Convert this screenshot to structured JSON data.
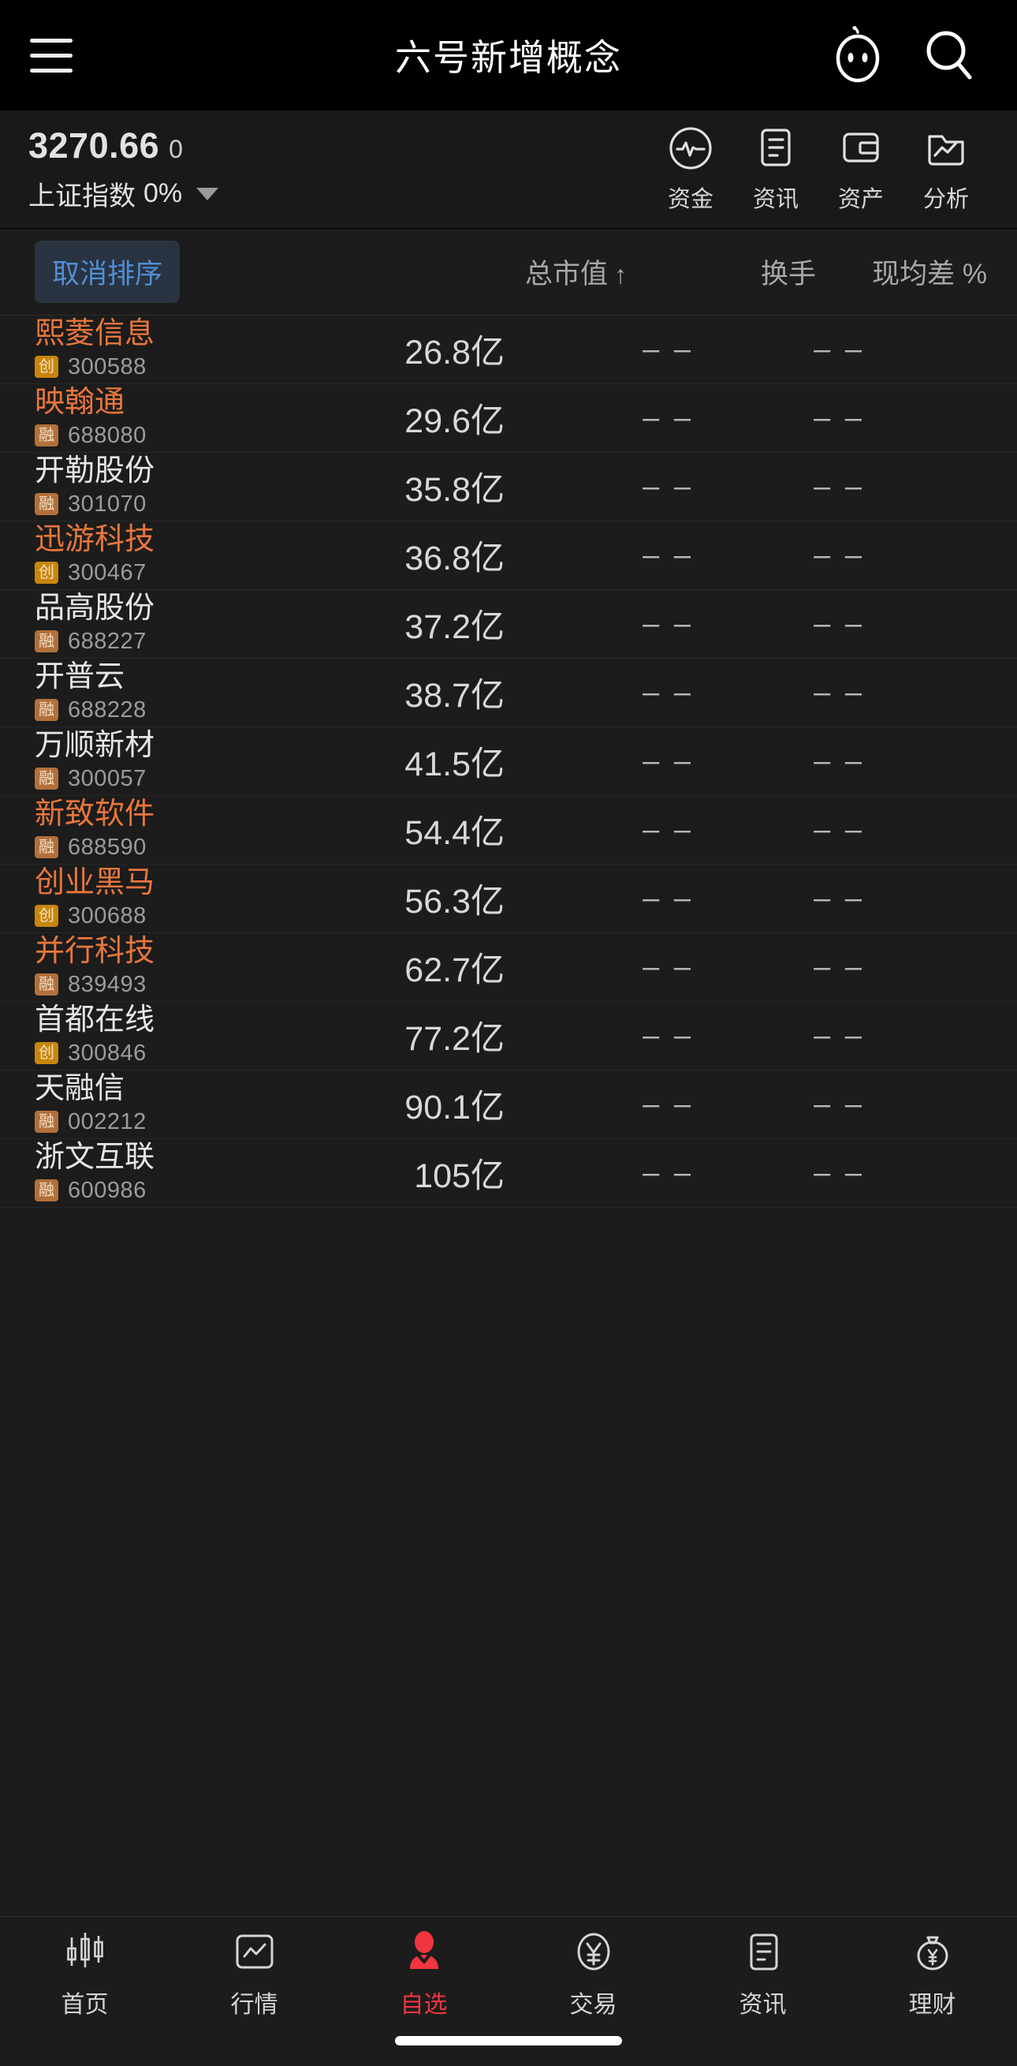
{
  "header": {
    "title": "六号新增概念",
    "menu_icon": "hamburger-menu-icon",
    "robot_icon": "robot-assistant-icon",
    "search_icon": "search-icon"
  },
  "index": {
    "value": "3270.66",
    "change": "0",
    "name": "上证指数",
    "percent": "0%",
    "dropdown_icon": "caret-down-icon"
  },
  "tools": [
    {
      "label": "资金",
      "icon": "pulse-circle-icon"
    },
    {
      "label": "资讯",
      "icon": "document-lines-icon"
    },
    {
      "label": "资产",
      "icon": "wallet-icon"
    },
    {
      "label": "分析",
      "icon": "folder-chart-icon"
    }
  ],
  "columns": {
    "sort_button": "取消排序",
    "market_cap": "总市值",
    "market_cap_arrow": "↑",
    "turnover": "换手",
    "diff": "现均差 %"
  },
  "colors": {
    "up": "#e8763c",
    "flat": "#e6e6e6",
    "accent_blue": "#4f8fd6",
    "active_red": "#f0353f",
    "badge_chuang": "#c8860d",
    "badge_rong": "#b2703a"
  },
  "stocks": [
    {
      "name": "熙菱信息",
      "badge": "创",
      "badge_type": "chuang",
      "code": "300588",
      "market_cap": "26.8亿",
      "turnover": "– –",
      "diff": "– –",
      "trend": "up"
    },
    {
      "name": "映翰通",
      "badge": "融",
      "badge_type": "rong",
      "code": "688080",
      "market_cap": "29.6亿",
      "turnover": "– –",
      "diff": "– –",
      "trend": "up"
    },
    {
      "name": "开勒股份",
      "badge": "融",
      "badge_type": "rong",
      "code": "301070",
      "market_cap": "35.8亿",
      "turnover": "– –",
      "diff": "– –",
      "trend": "flat"
    },
    {
      "name": "迅游科技",
      "badge": "创",
      "badge_type": "chuang",
      "code": "300467",
      "market_cap": "36.8亿",
      "turnover": "– –",
      "diff": "– –",
      "trend": "up"
    },
    {
      "name": "品高股份",
      "badge": "融",
      "badge_type": "rong",
      "code": "688227",
      "market_cap": "37.2亿",
      "turnover": "– –",
      "diff": "– –",
      "trend": "flat"
    },
    {
      "name": "开普云",
      "badge": "融",
      "badge_type": "rong",
      "code": "688228",
      "market_cap": "38.7亿",
      "turnover": "– –",
      "diff": "– –",
      "trend": "flat"
    },
    {
      "name": "万顺新材",
      "badge": "融",
      "badge_type": "rong",
      "code": "300057",
      "market_cap": "41.5亿",
      "turnover": "– –",
      "diff": "– –",
      "trend": "flat"
    },
    {
      "name": "新致软件",
      "badge": "融",
      "badge_type": "rong",
      "code": "688590",
      "market_cap": "54.4亿",
      "turnover": "– –",
      "diff": "– –",
      "trend": "up"
    },
    {
      "name": "创业黑马",
      "badge": "创",
      "badge_type": "chuang",
      "code": "300688",
      "market_cap": "56.3亿",
      "turnover": "– –",
      "diff": "– –",
      "trend": "up"
    },
    {
      "name": "并行科技",
      "badge": "融",
      "badge_type": "rong",
      "code": "839493",
      "market_cap": "62.7亿",
      "turnover": "– –",
      "diff": "– –",
      "trend": "up"
    },
    {
      "name": "首都在线",
      "badge": "创",
      "badge_type": "chuang",
      "code": "300846",
      "market_cap": "77.2亿",
      "turnover": "– –",
      "diff": "– –",
      "trend": "flat"
    },
    {
      "name": "天融信",
      "badge": "融",
      "badge_type": "rong",
      "code": "002212",
      "market_cap": "90.1亿",
      "turnover": "– –",
      "diff": "– –",
      "trend": "flat"
    },
    {
      "name": "浙文互联",
      "badge": "融",
      "badge_type": "rong",
      "code": "600986",
      "market_cap": "105亿",
      "turnover": "– –",
      "diff": "– –",
      "trend": "flat"
    }
  ],
  "bottom_nav": [
    {
      "label": "首页",
      "icon": "candlestick-icon",
      "active": false
    },
    {
      "label": "行情",
      "icon": "chart-square-icon",
      "active": false
    },
    {
      "label": "自选",
      "icon": "person-icon",
      "active": true
    },
    {
      "label": "交易",
      "icon": "yuan-circle-icon",
      "active": false
    },
    {
      "label": "资讯",
      "icon": "document-lines-icon",
      "active": false
    },
    {
      "label": "理财",
      "icon": "money-bag-icon",
      "active": false
    }
  ]
}
